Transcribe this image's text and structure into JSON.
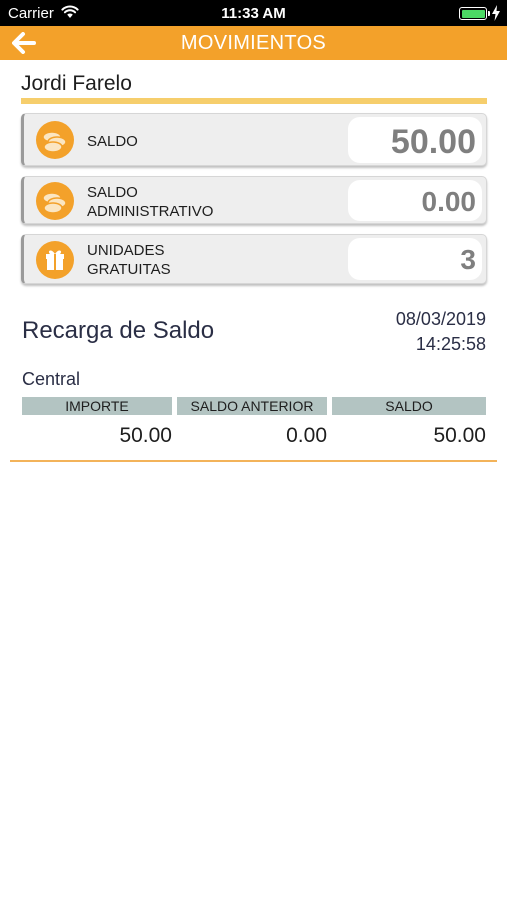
{
  "status_bar": {
    "carrier": "Carrier",
    "time": "11:33 AM",
    "battery_color": "#4cd964"
  },
  "nav": {
    "title": "MOVIMIENTOS",
    "back_icon": "arrow-left-icon",
    "color": "#f3a12a"
  },
  "user": {
    "name": "Jordi Farelo"
  },
  "balances": [
    {
      "label_line1": "SALDO",
      "label_line2": "",
      "value": "50.00",
      "icon": "coins-icon"
    },
    {
      "label_line1": "SALDO",
      "label_line2": "ADMINISTRATIVO",
      "value": "0.00",
      "icon": "coins-icon"
    },
    {
      "label_line1": "UNIDADES",
      "label_line2": "GRATUITAS",
      "value": "3",
      "icon": "gift-icon"
    }
  ],
  "movement": {
    "title": "Recarga de Saldo",
    "date": "08/03/2019",
    "time": "14:25:58",
    "origin": "Central",
    "columns": [
      "IMPORTE",
      "SALDO ANTERIOR",
      "SALDO"
    ],
    "values": [
      "50.00",
      "0.00",
      "50.00"
    ],
    "header_color": "#b3c4c2"
  }
}
